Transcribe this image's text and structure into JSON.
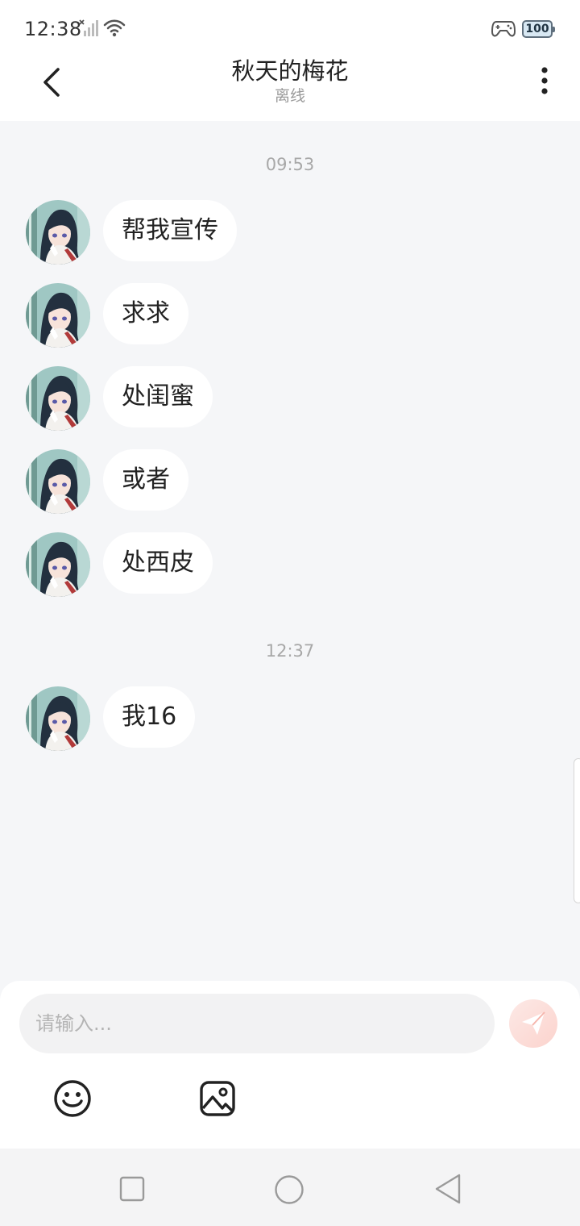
{
  "status_bar": {
    "time": "12:38",
    "battery": "100"
  },
  "header": {
    "title": "秋天的梅花",
    "subtitle": "离线"
  },
  "messages": {
    "groups": [
      {
        "time": "09:53",
        "items": [
          {
            "text": "帮我宣传"
          },
          {
            "text": "求求"
          },
          {
            "text": "处闺蜜"
          },
          {
            "text": "或者"
          },
          {
            "text": "处西皮"
          }
        ]
      },
      {
        "time": "12:37",
        "items": [
          {
            "text": "我16"
          }
        ]
      }
    ]
  },
  "input": {
    "placeholder": "请输入..."
  },
  "icons": {
    "back": "back-arrow-icon",
    "more": "more-vertical-icon",
    "send": "paper-plane-icon",
    "emoji": "smiley-icon",
    "image": "image-icon"
  },
  "colors": {
    "background": "#f5f6f8",
    "bubble": "#ffffff",
    "send_button": "#fbd3cd"
  }
}
